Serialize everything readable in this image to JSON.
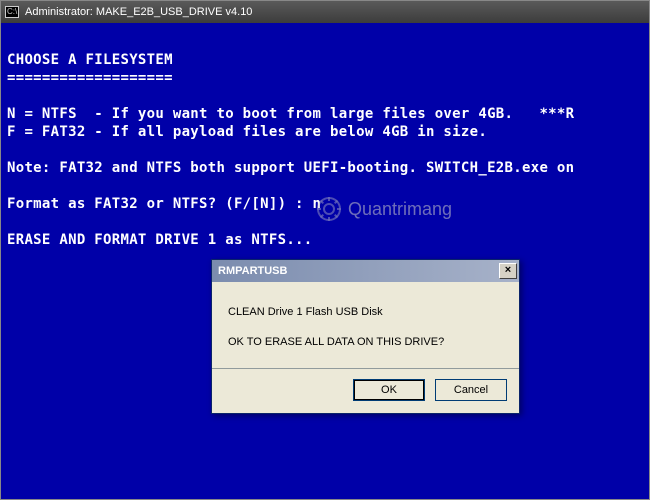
{
  "titlebar": {
    "icon_label": "C:\\",
    "title": "Administrator:  MAKE_E2B_USB_DRIVE v4.10"
  },
  "console": {
    "heading": "CHOOSE A FILESYSTEM",
    "underline": "===================",
    "line_n": "N = NTFS  - If you want to boot from large files over 4GB.   ***R",
    "line_f": "F = FAT32 - If all payload files are below 4GB in size.",
    "note": "Note: FAT32 and NTFS both support UEFI-booting. SWITCH_E2B.exe on",
    "prompt": "Format as FAT32 or NTFS? (F/[N]) : n",
    "status": "ERASE AND FORMAT DRIVE 1 as NTFS..."
  },
  "watermark": {
    "text": "Quantrimang"
  },
  "dialog": {
    "title": "RMPARTUSB",
    "line1": "CLEAN Drive 1  Flash USB Disk",
    "line2": "OK TO ERASE ALL DATA ON THIS DRIVE?",
    "ok": "OK",
    "cancel": "Cancel"
  }
}
